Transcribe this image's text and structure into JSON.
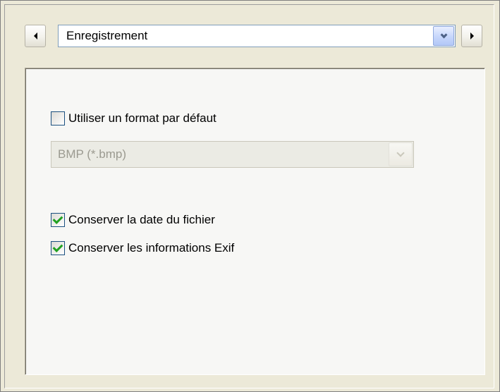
{
  "navigation": {
    "prev_icon": "chevron-left-icon",
    "next_icon": "chevron-right-icon",
    "section_selected": "Enregistrement",
    "section_dropdown_icon": "chevron-down-icon"
  },
  "options": {
    "use_default_format": {
      "label": "Utiliser un format par défaut",
      "checked": false
    },
    "format_select": {
      "value": "BMP (*.bmp)",
      "enabled": false
    },
    "keep_file_date": {
      "label": "Conserver la date du fichier",
      "checked": true
    },
    "keep_exif": {
      "label": "Conserver les informations Exif",
      "checked": true
    }
  },
  "colors": {
    "window_bg": "#ece9d8",
    "panel_bg": "#f7f7f5",
    "checkbox_border": "#1c5180",
    "checkmark": "#21a121",
    "disabled_text": "#9b9a90"
  }
}
